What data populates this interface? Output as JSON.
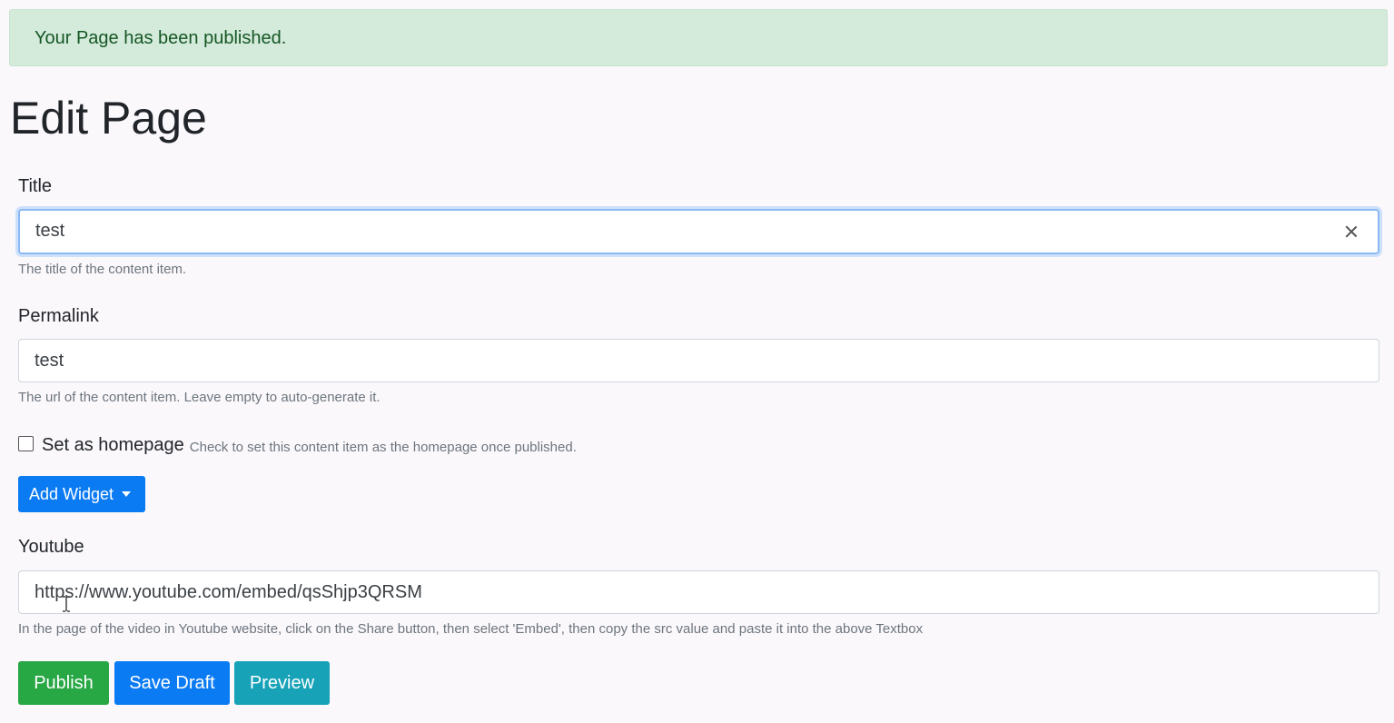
{
  "alert": {
    "message": "Your Page has been published."
  },
  "page_title": "Edit Page",
  "title_field": {
    "label": "Title",
    "value": "test",
    "help": "The title of the content item."
  },
  "permalink_field": {
    "label": "Permalink",
    "value": "test",
    "help": "The url of the content item. Leave empty to auto-generate it."
  },
  "homepage": {
    "label": "Set as homepage",
    "help": "Check to set this content item as the homepage once published.",
    "checked": false
  },
  "add_widget": {
    "label": "Add Widget"
  },
  "youtube_field": {
    "label": "Youtube",
    "value": "https://www.youtube.com/embed/qsShjp3QRSM",
    "help": "In the page of the video in Youtube website, click on the Share button, then select 'Embed', then copy the src value and paste it into the above Textbox"
  },
  "actions": {
    "publish": "Publish",
    "save_draft": "Save Draft",
    "preview": "Preview"
  },
  "colors": {
    "alert_bg": "#d4eadb",
    "primary": "#0b7bf3",
    "success": "#28a745",
    "info": "#17a2b8"
  }
}
